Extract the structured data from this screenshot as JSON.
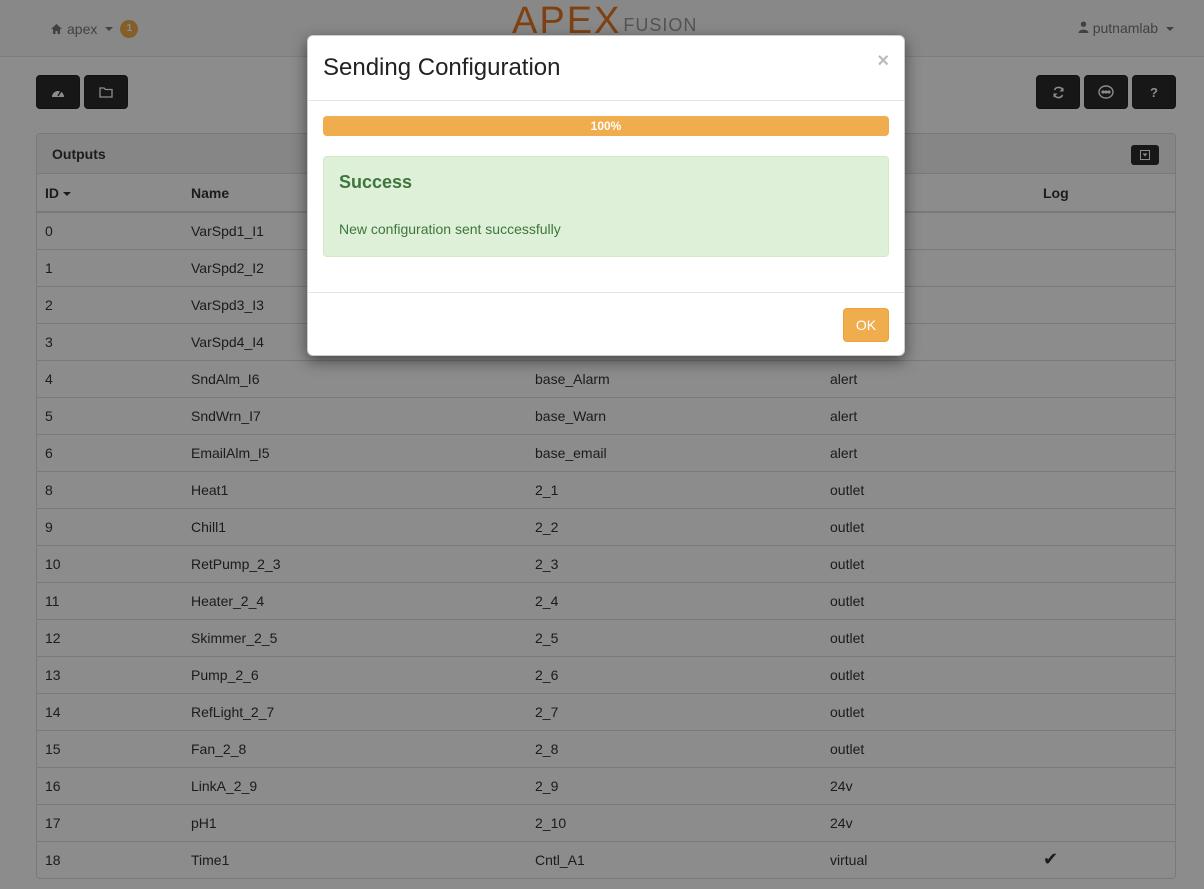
{
  "topbar": {
    "home_label": "apex",
    "notification_count": "1",
    "logo_apex": "APEX",
    "logo_fusion": "FUSION",
    "user_label": "putnamlab"
  },
  "toolbar": {
    "left_buttons": [
      "dashboard-icon",
      "folder-icon"
    ],
    "right_buttons": [
      "refresh-icon",
      "network-icon",
      "help-icon"
    ],
    "help_label": "?"
  },
  "panel": {
    "title": "Outputs",
    "columns": [
      "ID",
      "Name",
      "",
      "",
      "Log"
    ],
    "rows": [
      {
        "id": "0",
        "name": "VarSpd1_I1",
        "device": "",
        "type": "",
        "log": ""
      },
      {
        "id": "1",
        "name": "VarSpd2_I2",
        "device": "",
        "type": "",
        "log": ""
      },
      {
        "id": "2",
        "name": "VarSpd3_I3",
        "device": "",
        "type": "",
        "log": ""
      },
      {
        "id": "3",
        "name": "VarSpd4_I4",
        "device": "",
        "type": "",
        "log": ""
      },
      {
        "id": "4",
        "name": "SndAlm_I6",
        "device": "base_Alarm",
        "type": "alert",
        "log": ""
      },
      {
        "id": "5",
        "name": "SndWrn_I7",
        "device": "base_Warn",
        "type": "alert",
        "log": ""
      },
      {
        "id": "6",
        "name": "EmailAlm_I5",
        "device": "base_email",
        "type": "alert",
        "log": ""
      },
      {
        "id": "8",
        "name": "Heat1",
        "device": "2_1",
        "type": "outlet",
        "log": ""
      },
      {
        "id": "9",
        "name": "Chill1",
        "device": "2_2",
        "type": "outlet",
        "log": ""
      },
      {
        "id": "10",
        "name": "RetPump_2_3",
        "device": "2_3",
        "type": "outlet",
        "log": ""
      },
      {
        "id": "11",
        "name": "Heater_2_4",
        "device": "2_4",
        "type": "outlet",
        "log": ""
      },
      {
        "id": "12",
        "name": "Skimmer_2_5",
        "device": "2_5",
        "type": "outlet",
        "log": ""
      },
      {
        "id": "13",
        "name": "Pump_2_6",
        "device": "2_6",
        "type": "outlet",
        "log": ""
      },
      {
        "id": "14",
        "name": "RefLight_2_7",
        "device": "2_7",
        "type": "outlet",
        "log": ""
      },
      {
        "id": "15",
        "name": "Fan_2_8",
        "device": "2_8",
        "type": "outlet",
        "log": ""
      },
      {
        "id": "16",
        "name": "LinkA_2_9",
        "device": "2_9",
        "type": "24v",
        "log": ""
      },
      {
        "id": "17",
        "name": "pH1",
        "device": "2_10",
        "type": "24v",
        "log": ""
      },
      {
        "id": "18",
        "name": "Time1",
        "device": "Cntl_A1",
        "type": "virtual",
        "log": "✔"
      }
    ]
  },
  "modal": {
    "title": "Sending Configuration",
    "close_label": "×",
    "progress_percent": 100,
    "progress_label": "100%",
    "alert_title": "Success",
    "alert_message": "New configuration sent successfully",
    "ok_label": "OK"
  },
  "colors": {
    "accent": "#f0ad4e",
    "success_bg": "#dff0d8",
    "success_text": "#3c763d",
    "toolbar_button": "#2b2b2b"
  }
}
